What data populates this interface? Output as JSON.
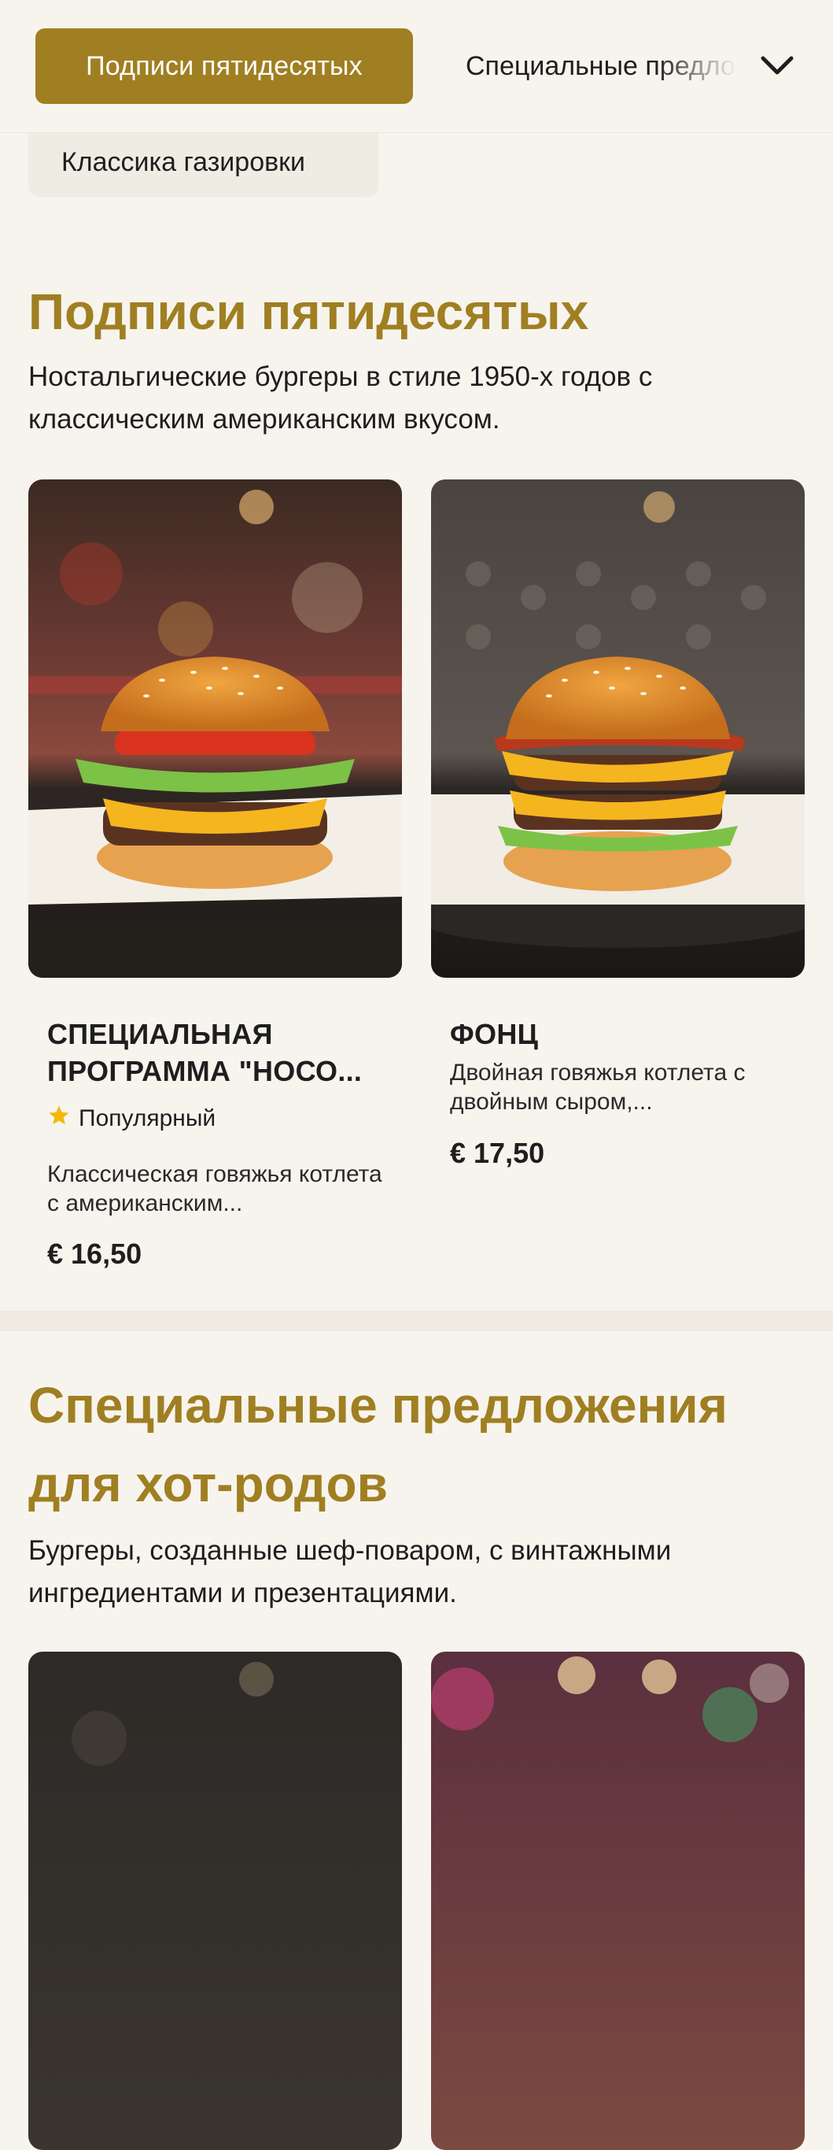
{
  "nav": {
    "active_tab": "Подписи пятидесятых",
    "next_tab": "Специальные предложения для хот-родов",
    "chip": "Классика газировки"
  },
  "sections": [
    {
      "title": "Подписи пятидесятых",
      "description": "Ностальгические бургеры в стиле 1950-х годов с классическим американским вкусом.",
      "items": [
        {
          "name": "СПЕЦИАЛЬНАЯ ПРОГРАММА \"НОСО...",
          "badge": "Популярный",
          "badge_icon": "star-icon",
          "description": "Классическая говяжья котлета с американским...",
          "price": "€ 16,50"
        },
        {
          "name": "ФОНЦ",
          "description": "Двойная говяжья котлета с двойным сыром,...",
          "price": "€ 17,50"
        }
      ]
    },
    {
      "title": "Специальные предложения для хот-родов",
      "description": "Бургеры, созданные шеф-поваром, с винтажными ингредиентами и презентациями."
    }
  ],
  "colors": {
    "accent": "#a07f22",
    "background": "#f7f4ee",
    "chip_bg": "#efece4",
    "star": "#f2b90c"
  }
}
